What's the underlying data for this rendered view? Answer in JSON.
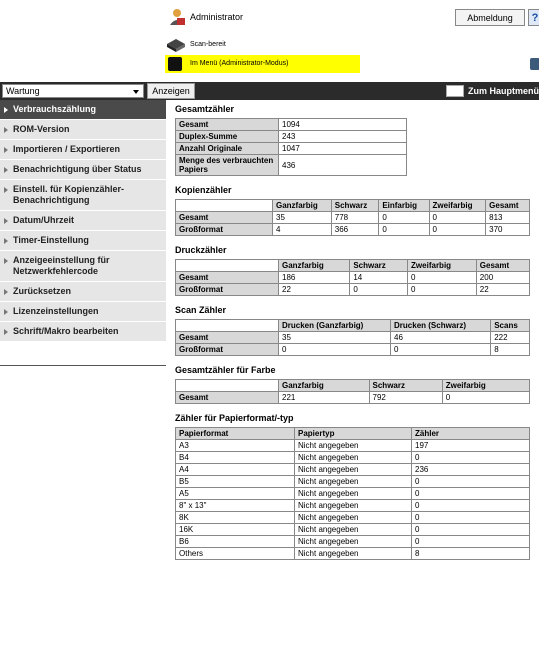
{
  "header": {
    "user": "Administrator",
    "logout": "Abmeldung",
    "help": "?",
    "status_ready": "Scan-bereit",
    "status_mode": "Im Menü (Administrator-Modus)"
  },
  "toolbar": {
    "menu_value": "Wartung",
    "show_button": "Anzeigen",
    "main_menu": "Zum Hauptmenü"
  },
  "sidebar": {
    "items": [
      {
        "label": "Verbrauchszählung",
        "active": true
      },
      {
        "label": "ROM-Version"
      },
      {
        "label": "Importieren / Exportieren"
      },
      {
        "label": "Benachrichtigung über Status"
      },
      {
        "label": "Einstell. für Kopienzähler-Benachrichtigung"
      },
      {
        "label": "Datum/Uhrzeit"
      },
      {
        "label": "Timer-Einstellung"
      },
      {
        "label": "Anzeigeeinstellung für Netzwerkfehlercode"
      },
      {
        "label": "Zurücksetzen"
      },
      {
        "label": "Lizenzeinstellungen"
      },
      {
        "label": "Schrift/Makro bearbeiten"
      }
    ]
  },
  "sections": {
    "total": {
      "title": "Gesamtzähler",
      "rows": [
        [
          "Gesamt",
          "1094"
        ],
        [
          "Duplex-Summe",
          "243"
        ],
        [
          "Anzahl Originale",
          "1047"
        ],
        [
          "Menge des verbrauchten Papiers",
          "436"
        ]
      ]
    },
    "copy": {
      "title": "Kopienzähler",
      "headers": [
        "Ganzfarbig",
        "Schwarz",
        "Einfarbig",
        "Zweifarbig",
        "Gesamt"
      ],
      "rows": [
        [
          "Gesamt",
          "35",
          "778",
          "0",
          "0",
          "813"
        ],
        [
          "Großformat",
          "4",
          "366",
          "0",
          "0",
          "370"
        ]
      ]
    },
    "print": {
      "title": "Druckzähler",
      "headers": [
        "Ganzfarbig",
        "Schwarz",
        "Zweifarbig",
        "Gesamt"
      ],
      "rows": [
        [
          "Gesamt",
          "186",
          "14",
          "0",
          "200"
        ],
        [
          "Großformat",
          "22",
          "0",
          "0",
          "22"
        ]
      ]
    },
    "scan": {
      "title": "Scan Zähler",
      "headers": [
        "Drucken (Ganzfarbig)",
        "Drucken (Schwarz)",
        "Scans"
      ],
      "rows": [
        [
          "Gesamt",
          "35",
          "46",
          "222"
        ],
        [
          "Großformat",
          "0",
          "0",
          "8"
        ]
      ]
    },
    "color": {
      "title": "Gesamtzähler für Farbe",
      "headers": [
        "Ganzfarbig",
        "Schwarz",
        "Zweifarbig"
      ],
      "rows": [
        [
          "Gesamt",
          "221",
          "792",
          "0"
        ]
      ]
    },
    "paper": {
      "title": "Zähler für Papierformat/-typ",
      "headers": [
        "Papierformat",
        "Papiertyp",
        "Zähler"
      ],
      "rows": [
        [
          "A3",
          "Nicht angegeben",
          "197"
        ],
        [
          "B4",
          "Nicht angegeben",
          "0"
        ],
        [
          "A4",
          "Nicht angegeben",
          "236"
        ],
        [
          "B5",
          "Nicht angegeben",
          "0"
        ],
        [
          "A5",
          "Nicht angegeben",
          "0"
        ],
        [
          "8\" x 13\"",
          "Nicht angegeben",
          "0"
        ],
        [
          "8K",
          "Nicht angegeben",
          "0"
        ],
        [
          "16K",
          "Nicht angegeben",
          "0"
        ],
        [
          "B6",
          "Nicht angegeben",
          "0"
        ],
        [
          "Others",
          "Nicht angegeben",
          "8"
        ]
      ]
    }
  }
}
